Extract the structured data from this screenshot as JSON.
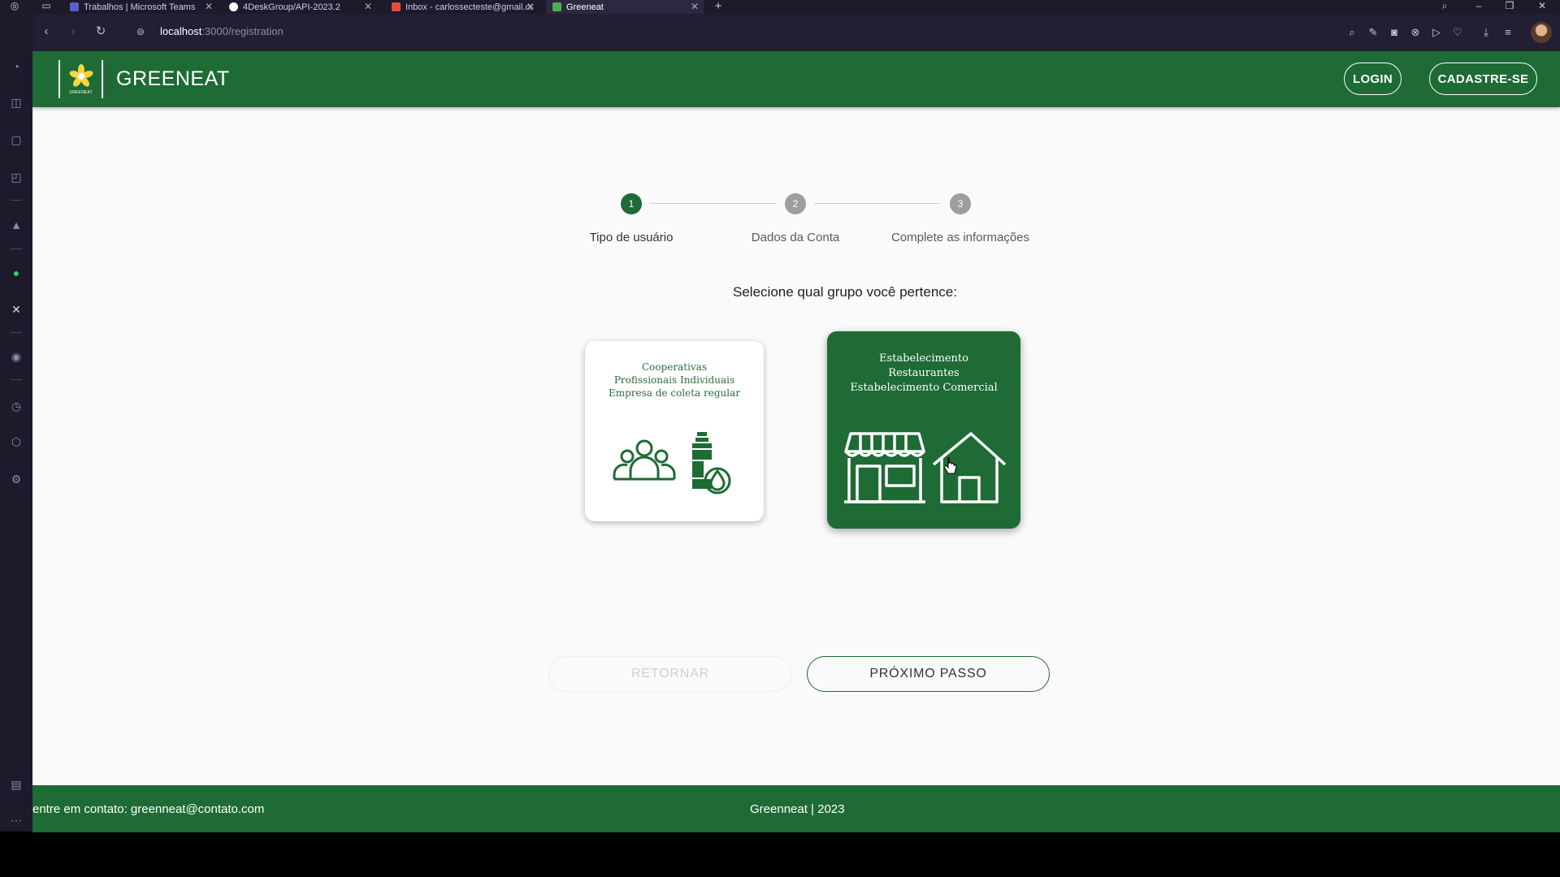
{
  "browser": {
    "tabs": [
      {
        "label": "Trabalhos | Microsoft Teams",
        "favicon_color": "#5b5fc7",
        "active": false
      },
      {
        "label": "4DeskGroup/API-2023.2",
        "favicon_color": "#ffffff",
        "active": false
      },
      {
        "label": "Inbox - carlossecteste@gmail.com",
        "favicon_color": "#e74c3c",
        "active": false
      },
      {
        "label": "Greeneat",
        "favicon_color": "#4caf50",
        "active": true
      }
    ],
    "new_tab": "+",
    "address": {
      "host": "localhost",
      "path": ":3000/registration"
    }
  },
  "header": {
    "logo_tiny_text": "GREENEAT",
    "brand": "GREENEAT",
    "login_label": "LOGIN",
    "signup_label": "CADASTRE-SE"
  },
  "stepper": {
    "steps": [
      {
        "number": "1",
        "label": "Tipo de usuário",
        "active": true
      },
      {
        "number": "2",
        "label": "Dados da Conta",
        "active": false
      },
      {
        "number": "3",
        "label": "Complete as informações",
        "active": false
      }
    ]
  },
  "prompt": "Selecione qual grupo você pertence:",
  "cards": {
    "collectors": {
      "lines": [
        "Cooperativas",
        "Profissionais Individuais",
        "Empresa de coleta regular"
      ],
      "icon": "people-bottle-icon",
      "selected": false
    },
    "establishment": {
      "lines": [
        "Estabelecimento",
        "Restaurantes",
        "Estabelecimento Comercial"
      ],
      "icon": "store-house-icon",
      "selected": true
    }
  },
  "actions": {
    "back_label": "RETORNAR",
    "next_label": "PRÓXIMO PASSO"
  },
  "footer": {
    "contact": "entre em contato: greenneat@contato.com",
    "copyright": "Greenneat | 2023"
  },
  "colors": {
    "brand_green": "#1e6b35",
    "inactive_step": "#9e9e9e"
  }
}
